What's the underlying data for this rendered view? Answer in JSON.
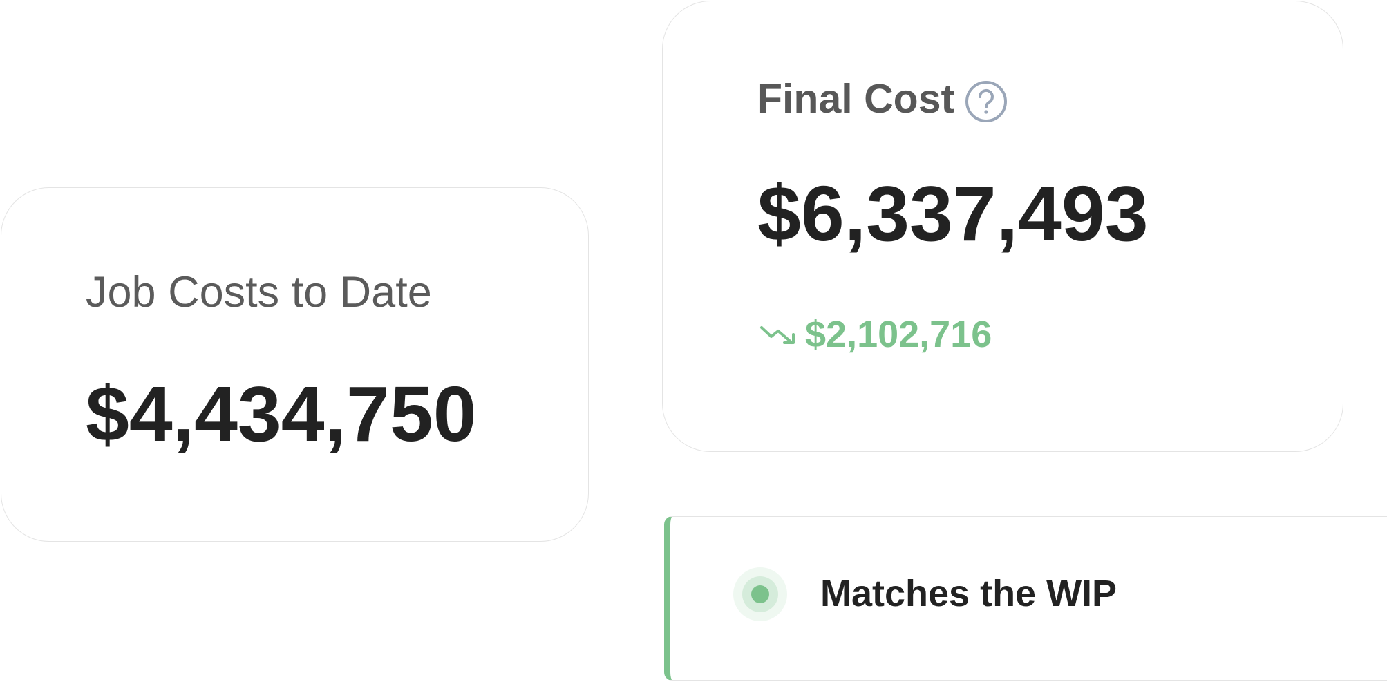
{
  "job_costs": {
    "label": "Job Costs to Date",
    "value": "$4,434,750"
  },
  "final_cost": {
    "label": "Final Cost",
    "value": "$6,337,493",
    "delta": "$2,102,716",
    "delta_icon": "trending-down-icon",
    "help_icon": "question-circle-icon"
  },
  "wip_status": {
    "text": "Matches the WIP",
    "status_icon": "status-dot-icon"
  },
  "colors": {
    "positive": "#7cc28c",
    "text_primary": "#222222",
    "text_secondary": "#5b5b5b",
    "card_border": "#e4e4e4",
    "icon_gray": "#9aa6b8"
  }
}
